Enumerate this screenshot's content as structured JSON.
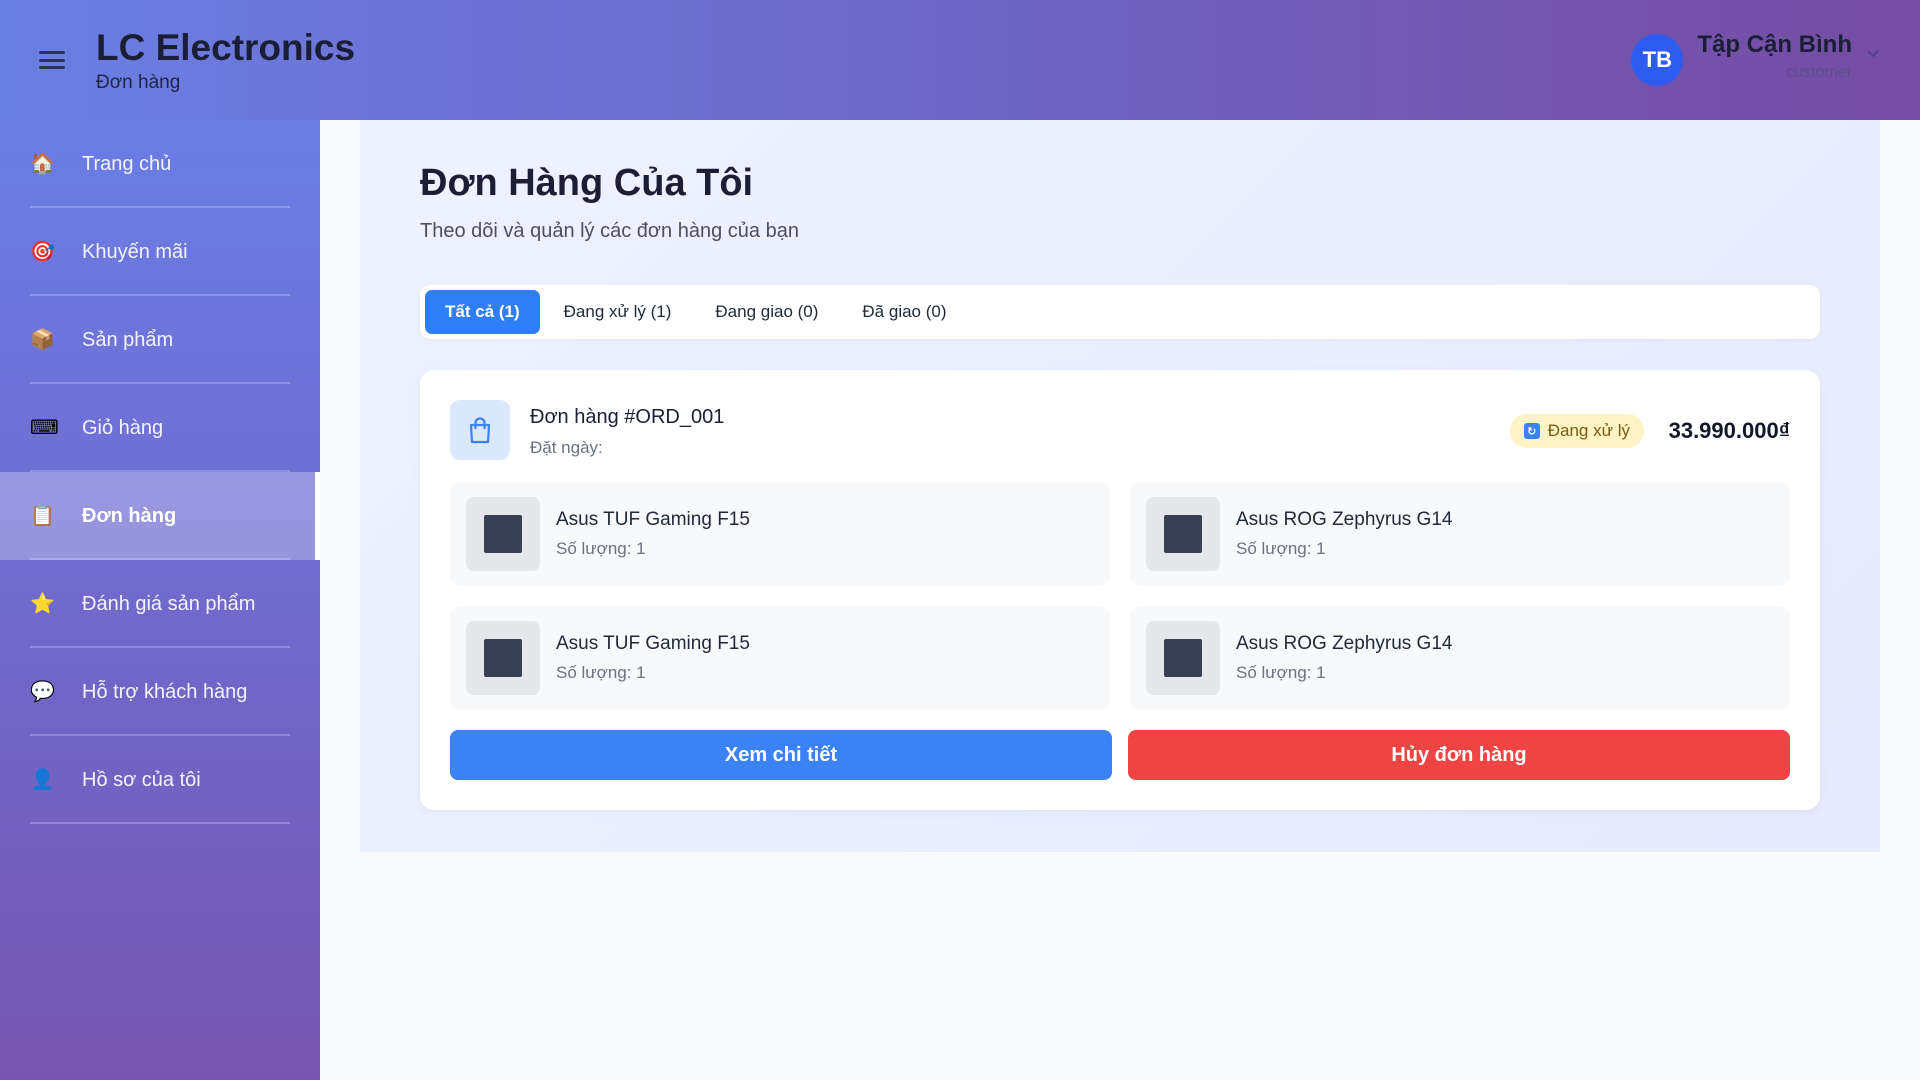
{
  "header": {
    "brand_title": "LC Electronics",
    "brand_subtitle": "Đơn hàng",
    "user_initials": "TB",
    "user_name": "Tập Cận Bình",
    "user_role": "customer"
  },
  "sidebar": {
    "items": [
      {
        "label": "Trang chủ",
        "icon": "🏠"
      },
      {
        "label": "Khuyến mãi",
        "icon": "🎯"
      },
      {
        "label": "Sản phẩm",
        "icon": "📦"
      },
      {
        "label": "Giỏ hàng",
        "icon": "⌨"
      },
      {
        "label": "Đơn hàng",
        "icon": "📋"
      },
      {
        "label": "Đánh giá sản phẩm",
        "icon": "⭐"
      },
      {
        "label": "Hỗ trợ khách hàng",
        "icon": "💬"
      },
      {
        "label": "Hồ sơ của tôi",
        "icon": "👤"
      }
    ]
  },
  "main": {
    "title": "Đơn Hàng Của Tôi",
    "subtitle": "Theo dõi và quản lý các đơn hàng của bạn",
    "tabs": [
      {
        "label": "Tất cả (1)"
      },
      {
        "label": "Đang xử lý (1)"
      },
      {
        "label": "Đang giao (0)"
      },
      {
        "label": "Đã giao (0)"
      }
    ],
    "order": {
      "id": "Đơn hàng #ORD_001",
      "date_label": "Đặt ngày:",
      "status": "Đang xử lý",
      "total": "33.990.000₫",
      "items": [
        {
          "name": "Asus TUF Gaming F15",
          "qty": "Số lượng: 1"
        },
        {
          "name": "Asus ROG Zephyrus G14",
          "qty": "Số lượng: 1"
        },
        {
          "name": "Asus TUF Gaming F15",
          "qty": "Số lượng: 1"
        },
        {
          "name": "Asus ROG Zephyrus G14",
          "qty": "Số lượng: 1"
        }
      ],
      "detail_button": "Xem chi tiết",
      "cancel_button": "Hủy đơn hàng"
    }
  },
  "colors": {
    "primary": "#3b82f6",
    "danger": "#ef4444",
    "status_bg": "#fdf3c4",
    "header_start": "#6a7fe2",
    "header_end": "#764ba2"
  }
}
